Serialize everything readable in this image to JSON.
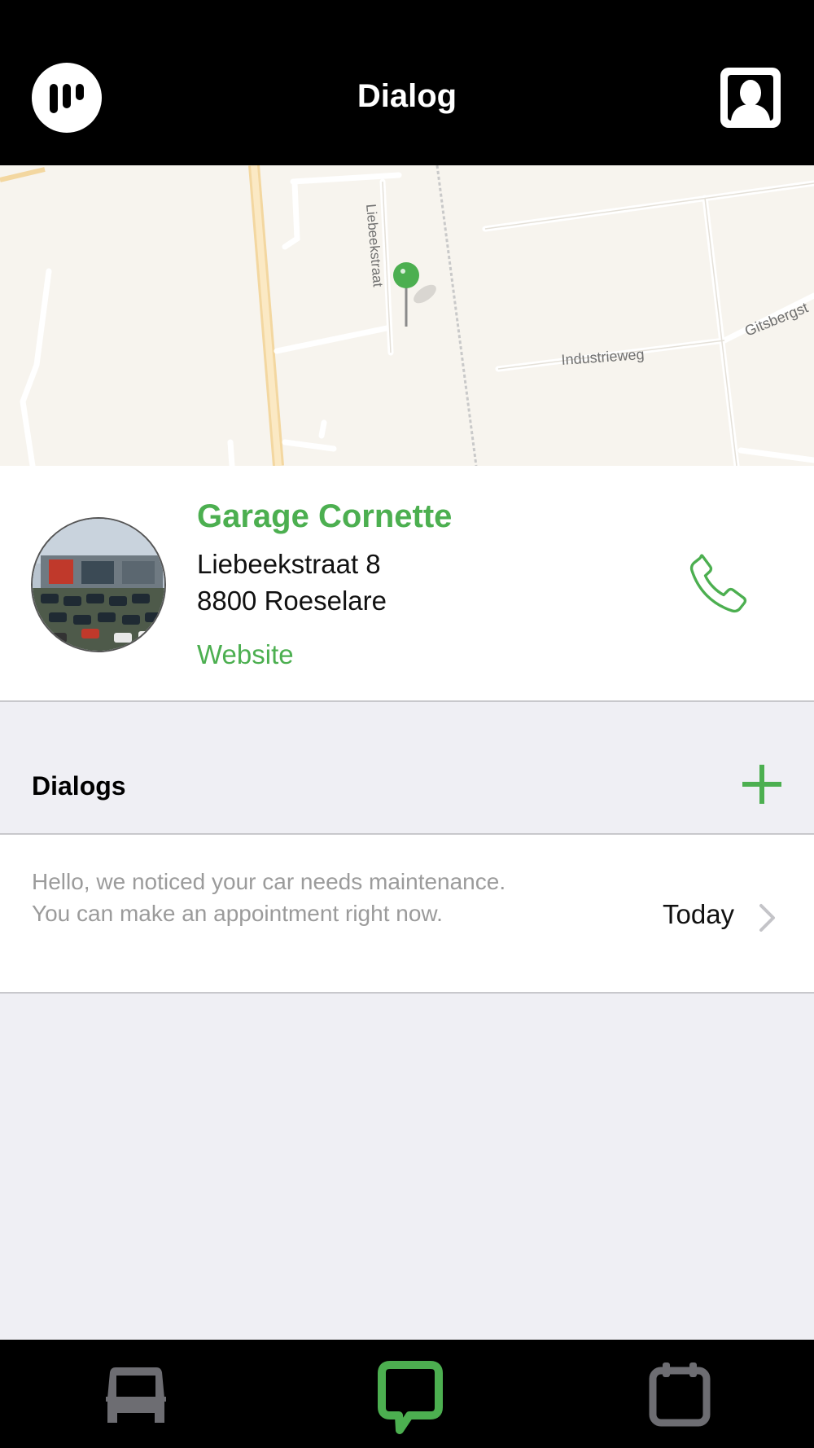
{
  "header": {
    "title": "Dialog",
    "logo_icon": "brand-logo-icon",
    "profile_icon": "profile-icon"
  },
  "map": {
    "street_labels": [
      "Liebeekstraat",
      "Industrieweg",
      "Gitsbergst"
    ],
    "pin_color": "#4caf50"
  },
  "garage": {
    "name": "Garage Cornette",
    "address_line1": "Liebeekstraat 8",
    "address_line2": "8800 Roeselare",
    "website_label": "Website",
    "phone_icon": "phone-icon",
    "accent_color": "#4caf50"
  },
  "dialogs": {
    "title": "Dialogs",
    "add_icon": "plus-icon",
    "items": [
      {
        "preview_line1": "Hello, we noticed your car needs maintenance.",
        "preview_line2": "You can make an appointment right now.",
        "date": "Today"
      }
    ]
  },
  "tabbar": {
    "tabs": [
      {
        "icon": "car-icon",
        "active": false
      },
      {
        "icon": "chat-icon",
        "active": true
      },
      {
        "icon": "calendar-icon",
        "active": false
      }
    ],
    "active_color": "#4caf50",
    "inactive_color": "#6d6d72"
  }
}
